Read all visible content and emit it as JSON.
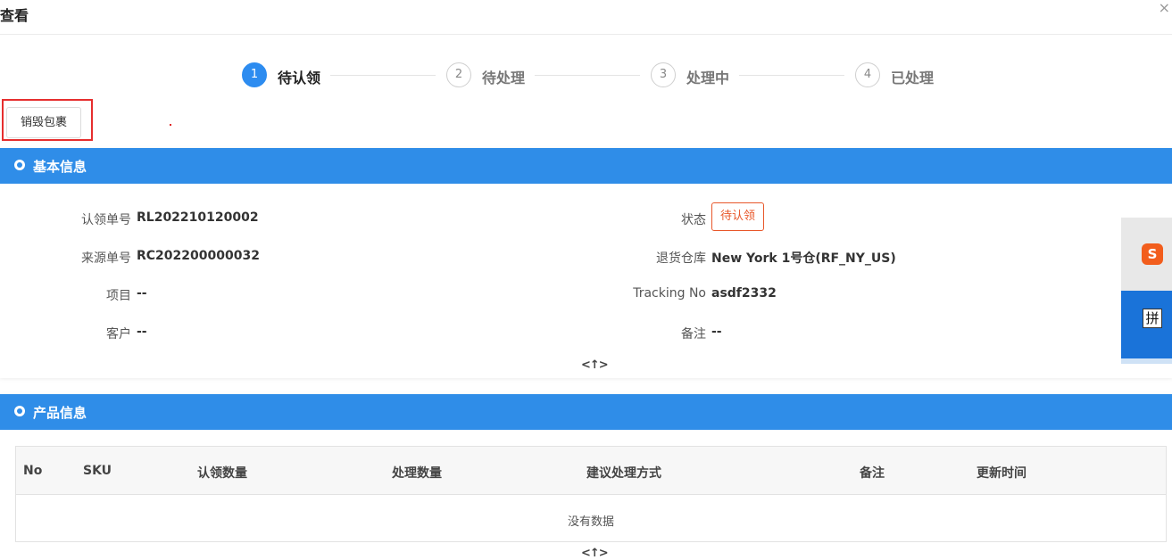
{
  "dialog": {
    "title": "查看",
    "close_glyph": "×"
  },
  "steps": [
    {
      "number": "1",
      "label": "待认领",
      "active": true
    },
    {
      "number": "2",
      "label": "待处理",
      "active": false
    },
    {
      "number": "3",
      "label": "处理中",
      "active": false
    },
    {
      "number": "4",
      "label": "已处理",
      "active": false
    }
  ],
  "actions": {
    "destroy_package": "销毁包裹"
  },
  "basic_info": {
    "section_title": "基本信息",
    "claim_no_label": "认领单号",
    "claim_no": "RL202210120002",
    "source_no_label": "来源单号",
    "source_no": "RC202200000032",
    "project_label": "项目",
    "project": "--",
    "customer_label": "客户",
    "customer": "--",
    "status_label": "状态",
    "status": "待认领",
    "warehouse_label": "退货仓库",
    "warehouse": "New York 1号仓(RF_NY_US)",
    "tracking_label": "Tracking No",
    "tracking": "asdf2332",
    "remark_label": "备注",
    "remark": "--",
    "collapse_glyph": "<↑>"
  },
  "product_info": {
    "section_title": "产品信息",
    "columns": [
      "No",
      "SKU",
      "认领数量",
      "处理数量",
      "建议处理方式",
      "备注",
      "更新时间"
    ],
    "empty_text": "没有数据",
    "collapse_glyph": "<↑>"
  },
  "side_widget": {
    "logo_text": "S",
    "mode_text": "拼"
  },
  "colors": {
    "primary": "#2f8de8",
    "step_active": "#2d8cf0",
    "status": "#e8572a",
    "highlight": "#e62e2e"
  }
}
